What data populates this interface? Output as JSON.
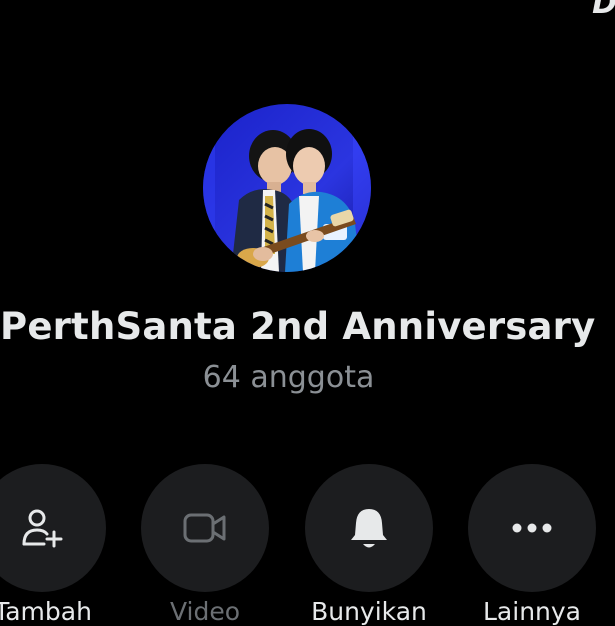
{
  "group": {
    "name": "PerthSanta 2nd Anniversary",
    "member_count": "64 anggota",
    "avatar_icon": "group-photo-avatar"
  },
  "actions": [
    {
      "label": "Tambah",
      "icon": "add-person-icon",
      "enabled": true
    },
    {
      "label": "Video",
      "icon": "video-camera-icon",
      "enabled": false
    },
    {
      "label": "Bunyikan",
      "icon": "bell-icon",
      "enabled": true
    },
    {
      "label": "Lainnya",
      "icon": "more-dots-icon",
      "enabled": true
    }
  ],
  "colors": {
    "background": "#000000",
    "button_bg": "#1c1d1f",
    "text_primary": "#e7e9ea",
    "text_secondary": "#8b9095",
    "text_disabled": "#6b6f73"
  }
}
